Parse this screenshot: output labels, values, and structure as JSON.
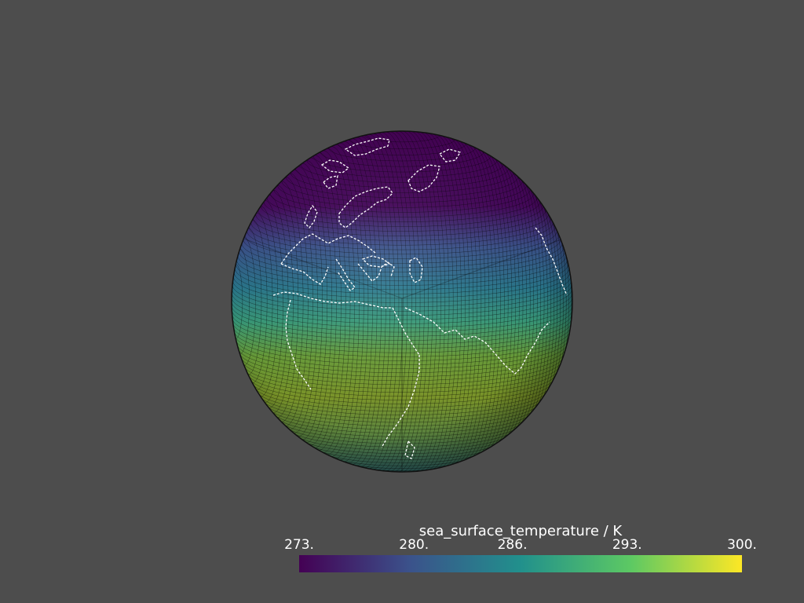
{
  "scene": {
    "background": "#4d4d4d",
    "mesh_edge_color": "#000000",
    "coastline_color": "#ffffff",
    "colormap": "viridis",
    "view": "orthographic globe centred on Europe / Africa"
  },
  "colorbar": {
    "title": "sea_surface_temperature / K",
    "range": [
      273,
      300
    ],
    "ticks": [
      {
        "label": "273.",
        "value": 273
      },
      {
        "label": "280.",
        "value": 280
      },
      {
        "label": "286.",
        "value": 286
      },
      {
        "label": "293.",
        "value": 293
      },
      {
        "label": "300.",
        "value": 300
      }
    ],
    "stops": [
      "#440154",
      "#3b528b",
      "#21908c",
      "#5dc963",
      "#fde725"
    ]
  }
}
